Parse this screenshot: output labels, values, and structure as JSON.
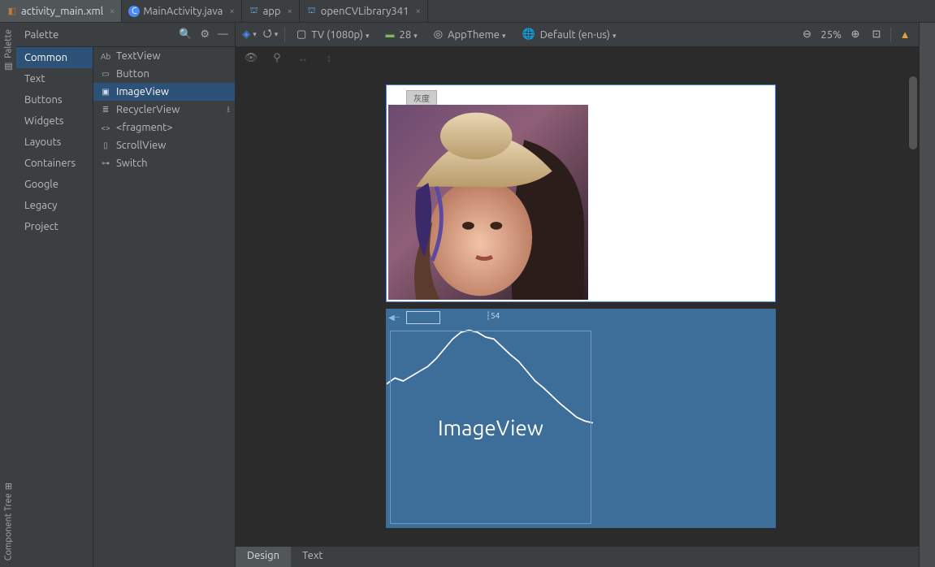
{
  "tabs": [
    {
      "label": "activity_main.xml",
      "type": "xml",
      "active": true
    },
    {
      "label": "MainActivity.java",
      "type": "java",
      "active": false
    },
    {
      "label": "app",
      "type": "mod",
      "active": false
    },
    {
      "label": "openCVLibrary341",
      "type": "mod",
      "active": false
    }
  ],
  "palette": {
    "title": "Palette",
    "categories": [
      "Common",
      "Text",
      "Buttons",
      "Widgets",
      "Layouts",
      "Containers",
      "Google",
      "Legacy",
      "Project"
    ],
    "selectedCategory": "Common",
    "components": [
      {
        "label": "TextView",
        "glyph": "Ab"
      },
      {
        "label": "Button",
        "glyph": "▭"
      },
      {
        "label": "ImageView",
        "glyph": "▣",
        "selected": true
      },
      {
        "label": "RecyclerView",
        "glyph": "≣",
        "dl": true
      },
      {
        "label": "<fragment>",
        "glyph": "<>"
      },
      {
        "label": "ScrollView",
        "glyph": "▯"
      },
      {
        "label": "Switch",
        "glyph": "⊶"
      }
    ]
  },
  "toolbar": {
    "device": "TV (1080p)",
    "api": "28",
    "theme": "AppTheme",
    "locale": "Default (en-us)",
    "zoom": "25%"
  },
  "canvas": {
    "grayButton": "灰度",
    "imageViewLabel": "ImageView",
    "anchorValue": "54"
  },
  "sideLabels": {
    "palette": "Palette",
    "componentTree": "Component Tree"
  },
  "bottomTabs": {
    "design": "Design",
    "text": "Text"
  },
  "chart_data": {
    "type": "line",
    "title": "histogram-like curve drawn inside lower ImageView placeholder",
    "x": [
      0,
      10,
      20,
      30,
      40,
      50,
      60,
      70,
      80,
      90,
      100,
      110,
      120,
      130,
      140,
      150,
      160,
      170,
      180,
      190,
      200,
      210,
      220,
      230,
      240,
      250
    ],
    "y": [
      58,
      52,
      55,
      50,
      45,
      40,
      32,
      22,
      12,
      5,
      3,
      5,
      10,
      12,
      20,
      28,
      35,
      45,
      55,
      62,
      70,
      78,
      85,
      92,
      96,
      98
    ],
    "xlim": [
      0,
      256
    ],
    "ylim": [
      0,
      100
    ],
    "note": "y values are normalized pixel-heights from top of panel; curve peaks near x≈85"
  }
}
